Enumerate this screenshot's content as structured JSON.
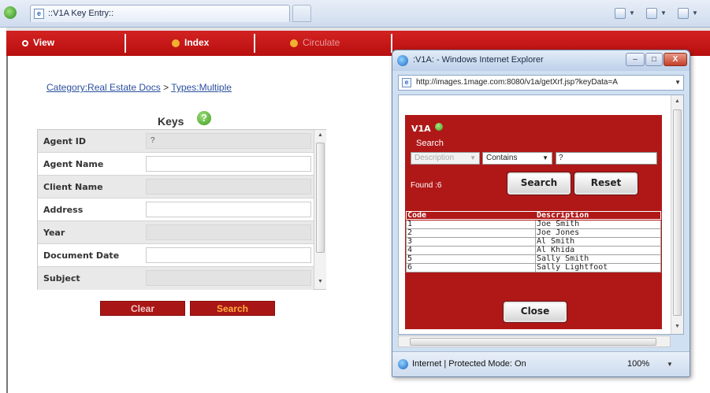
{
  "browser": {
    "tab_icon": "ie-page-icon",
    "tab_title": "::V1A Key Entry::",
    "command_icons": [
      "home-icon",
      "feeds-icon",
      "print-icon"
    ]
  },
  "nav": {
    "view": "View",
    "index": "Index",
    "circulate": "Circulate"
  },
  "breadcrumb": {
    "category": "Category:Real Estate Docs",
    "separator": ">",
    "types": "Types:Multiple"
  },
  "keys": {
    "title": "Keys",
    "help_icon": "?",
    "rows": [
      {
        "label": "Agent ID",
        "value": "?",
        "style": "grey"
      },
      {
        "label": "Agent Name",
        "value": "",
        "style": "white"
      },
      {
        "label": "Client Name",
        "value": "",
        "style": "grey"
      },
      {
        "label": "Address",
        "value": "",
        "style": "white"
      },
      {
        "label": "Year",
        "value": "",
        "style": "grey"
      },
      {
        "label": "Document Date",
        "value": "",
        "style": "white"
      },
      {
        "label": "Subject",
        "value": "",
        "style": "grey"
      }
    ]
  },
  "buttons": {
    "clear": "Clear",
    "search": "Search"
  },
  "popup": {
    "title": ":V1A: - Windows Internet Explorer",
    "url": "http://images.1mage.com:8080/v1a/getXrf.jsp?keyData=A",
    "min": "–",
    "max": "□",
    "close": "X",
    "via_title": "V1A",
    "search_label": "Search",
    "field_select": "Description",
    "operator_select": "Contains",
    "search_value": "?",
    "found": "Found :6",
    "search_button": "Search",
    "reset_button": "Reset",
    "col_code": "Code",
    "col_description": "Description",
    "results": [
      {
        "code": "1",
        "description": "Joe Smith"
      },
      {
        "code": "2",
        "description": "Joe Jones"
      },
      {
        "code": "3",
        "description": "Al Smith"
      },
      {
        "code": "4",
        "description": "Al Khida"
      },
      {
        "code": "5",
        "description": "Sally Smith"
      },
      {
        "code": "6",
        "description": "Sally Lightfoot"
      }
    ],
    "close_button": "Close",
    "status_text": "Internet | Protected Mode: On",
    "zoom": "100%"
  },
  "colors": {
    "nav_red": "#c41a1a",
    "panel_red": "#b01818",
    "search_orange": "#ffae3a",
    "link_blue": "#2a4f9e"
  }
}
